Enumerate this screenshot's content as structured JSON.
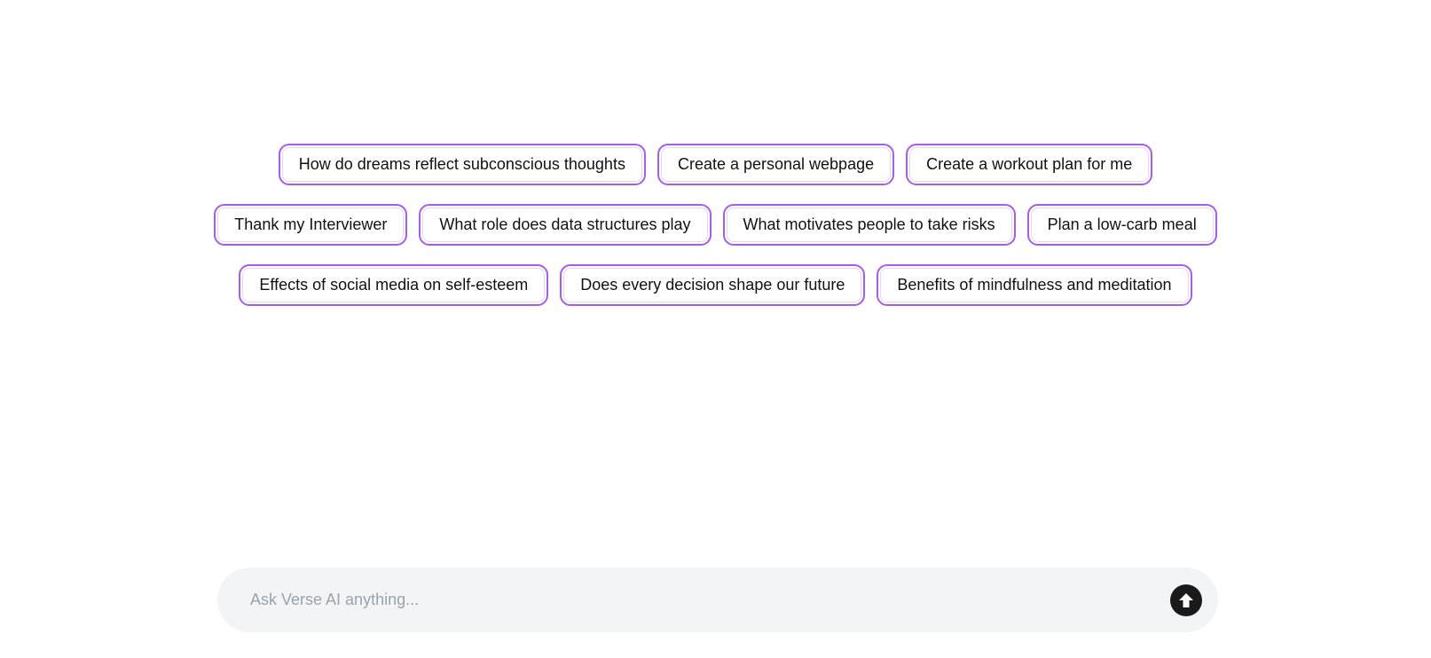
{
  "suggestions": {
    "rows": [
      [
        "How do dreams reflect subconscious thoughts",
        "Create a personal webpage",
        "Create a workout plan for me"
      ],
      [
        "Thank my Interviewer",
        "What role does data structures play",
        "What motivates people to take risks",
        "Plan a low-carb meal"
      ],
      [
        "Effects of social media on self-esteem",
        "Does every decision shape our future",
        "Benefits of mindfulness and meditation"
      ]
    ]
  },
  "composer": {
    "placeholder": "Ask Verse AI anything...",
    "value": "",
    "send_icon": "arrow-up-circle-icon"
  },
  "colors": {
    "chip_border": "#a55eea",
    "composer_bg": "#f3f4f6",
    "send_button_bg": "#1a1a1a"
  }
}
